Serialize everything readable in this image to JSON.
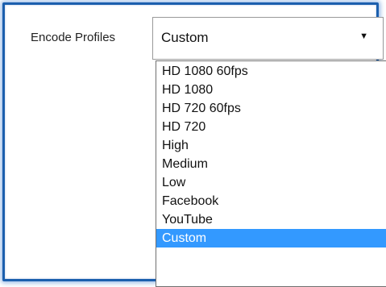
{
  "field": {
    "label": "Encode Profiles",
    "selected_value": "Custom",
    "arrow_icon": "caret-down-icon"
  },
  "dropdown": {
    "options": [
      "HD 1080 60fps",
      "HD 1080",
      "HD 720 60fps",
      "HD 720",
      "High",
      "Medium",
      "Low",
      "Facebook",
      "YouTube",
      "Custom"
    ],
    "selected_option": "Custom"
  },
  "colors": {
    "highlight": "#3399ff",
    "frame_border": "#1b5fae"
  }
}
